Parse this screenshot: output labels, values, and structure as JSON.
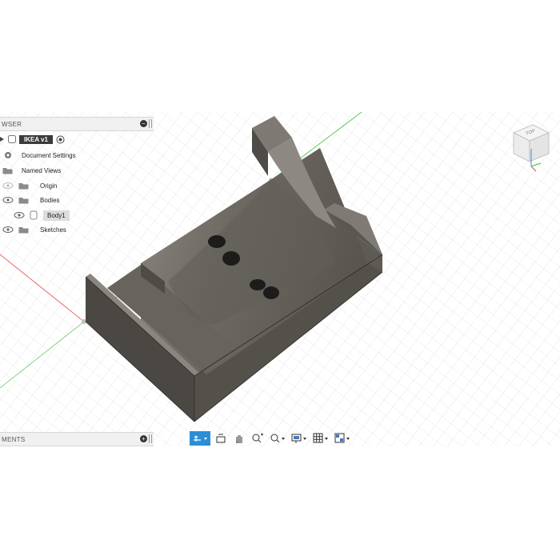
{
  "browser": {
    "header_label": "WSER",
    "root_label": "IKEA v1",
    "items": [
      {
        "label": "Document Settings",
        "icon": "gear-icon"
      },
      {
        "label": "Named Views",
        "icon": "folder-icon"
      },
      {
        "label": "Origin",
        "icon": "folder-icon"
      },
      {
        "label": "Bodies",
        "icon": "folder-icon"
      },
      {
        "label": "Body1",
        "icon": "body-icon"
      },
      {
        "label": "Sketches",
        "icon": "folder-icon"
      }
    ]
  },
  "comments": {
    "header_label": "MENTS"
  },
  "viewcube": {
    "face_label": "TOP"
  },
  "navbar": {
    "tools": [
      "orbit-icon",
      "look-at-icon",
      "pan-icon",
      "zoom-window-icon",
      "zoom-icon",
      "display-settings-icon",
      "grid-settings-icon",
      "viewports-icon"
    ]
  },
  "colors": {
    "accent": "#2a8fd6",
    "model": "#6f6b65",
    "axis_red": "#e04a4a",
    "axis_green": "#3bbd3b"
  }
}
